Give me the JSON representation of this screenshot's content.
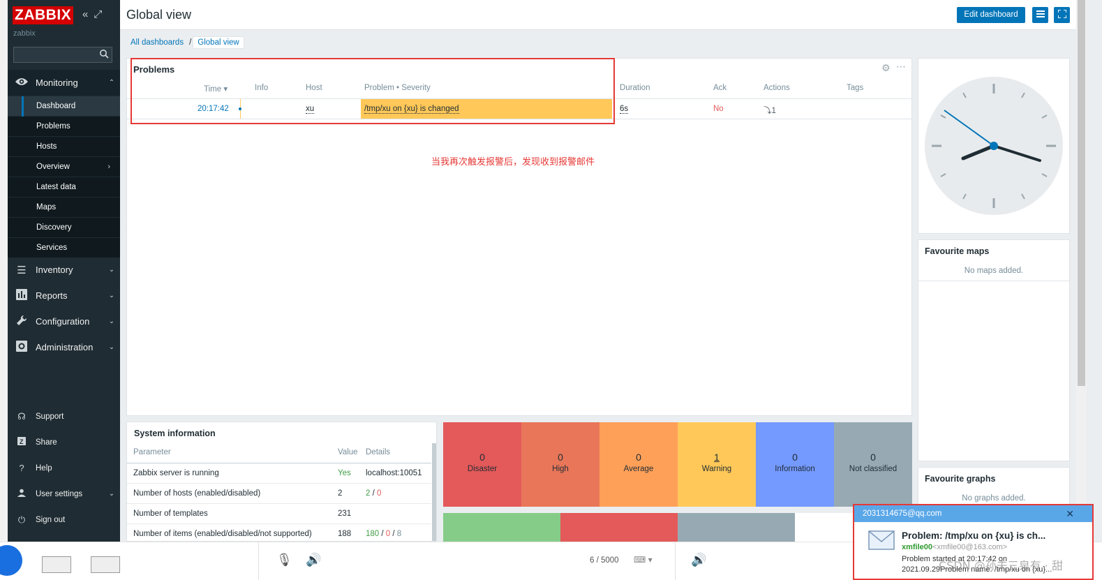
{
  "sidebar": {
    "logo": "ZABBIX",
    "collapse_icons": [
      "«",
      "⤢"
    ],
    "server_name": "zabbix",
    "monitoring": "Monitoring",
    "submenu": [
      "Dashboard",
      "Problems",
      "Hosts",
      "Overview",
      "Latest data",
      "Maps",
      "Discovery",
      "Services"
    ],
    "inventory": "Inventory",
    "reports": "Reports",
    "configuration": "Configuration",
    "administration": "Administration",
    "support": "Support",
    "share": "Share",
    "help": "Help",
    "user_settings": "User settings",
    "sign_out": "Sign out"
  },
  "header": {
    "title": "Global view",
    "edit_button": "Edit dashboard"
  },
  "breadcrumb": {
    "all": "All dashboards",
    "sep": "/",
    "current": "Global view"
  },
  "problems": {
    "title": "Problems",
    "columns": [
      "Time ▾",
      "Info",
      "Host",
      "Problem • Severity",
      "Duration",
      "Ack",
      "Actions",
      "Tags"
    ],
    "row": {
      "time": "20:17:42",
      "host": "xu",
      "problem": "/tmp/xu on {xu} is changed",
      "duration": "6s",
      "ack": "No",
      "actions": "⤵1"
    },
    "annotation": "当我再次触发报警后，发现收到报警邮件"
  },
  "system_info": {
    "title": "System information",
    "columns": [
      "Parameter",
      "Value",
      "Details"
    ],
    "rows": [
      {
        "param": "Zabbix server is running",
        "value": "Yes",
        "details": "localhost:10051"
      },
      {
        "param": "Number of hosts (enabled/disabled)",
        "value": "2",
        "d1": "2",
        "d2": "0"
      },
      {
        "param": "Number of templates",
        "value": "231",
        "details": ""
      },
      {
        "param": "Number of items (enabled/disabled/not supported)",
        "value": "188",
        "d1": "180",
        "d2": "0",
        "d3": "8"
      }
    ]
  },
  "severity": [
    {
      "count": "0",
      "label": "Disaster",
      "color": "#e45959"
    },
    {
      "count": "0",
      "label": "High",
      "color": "#e97659"
    },
    {
      "count": "0",
      "label": "Average",
      "color": "#ffa059"
    },
    {
      "count": "1",
      "label": "Warning",
      "color": "#ffc859"
    },
    {
      "count": "0",
      "label": "Information",
      "color": "#7499ff"
    },
    {
      "count": "0",
      "label": "Not classified",
      "color": "#97aab3"
    }
  ],
  "favourite_maps": {
    "title": "Favourite maps",
    "empty": "No maps added."
  },
  "favourite_graphs": {
    "title": "Favourite graphs",
    "empty": "No graphs added."
  },
  "taskbar": {
    "counter": "6 / 5000"
  },
  "toast": {
    "from": "2031314675@qq.com",
    "subject": "Problem: /tmp/xu on {xu} is ch...",
    "sender_name": "xmfile00",
    "sender_addr": "<xmfile00@163.com>",
    "line1": "Problem started at 20:17:42 on",
    "line2": "2021.09.29Problem name: /tmp/xu on {xu}..."
  },
  "watermark": "CSDN @孙夫三泉有 · 甜"
}
